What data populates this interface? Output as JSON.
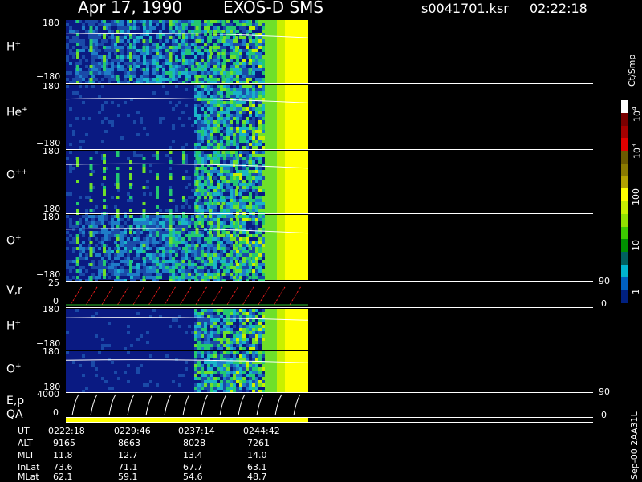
{
  "header": {
    "date": "Apr 17, 1990",
    "mission": "EXOS-D SMS",
    "file": "s0041701.ksr",
    "time": "02:22:18"
  },
  "panels": [
    {
      "label": "H",
      "sup": "+",
      "top_tick": "180",
      "bottom_tick": "−180"
    },
    {
      "label": "He",
      "sup": "+",
      "top_tick": "180",
      "bottom_tick": "−180"
    },
    {
      "label": "O",
      "sup": "++",
      "top_tick": "180",
      "bottom_tick": "−180"
    },
    {
      "label": "O",
      "sup": "+",
      "top_tick": "180",
      "bottom_tick": "−180"
    },
    {
      "label": "V,r",
      "sup": "",
      "top_tick": "25",
      "bottom_tick": "0",
      "right_top": "90",
      "right_bottom": "0"
    },
    {
      "label": "H",
      "sup": "+",
      "top_tick": "180",
      "bottom_tick": "−180"
    },
    {
      "label": "O",
      "sup": "+",
      "top_tick": "180",
      "bottom_tick": "−180"
    },
    {
      "label": "E,p",
      "sup": "",
      "top_tick": "4000",
      "bottom_tick": "0",
      "right_top": "90",
      "right_bottom": "0"
    },
    {
      "label": "QA",
      "sup": "",
      "top_tick": "",
      "bottom_tick": ""
    }
  ],
  "colorbar": {
    "unit": "Ct/Smp",
    "labels": [
      "10",
      "10",
      "100",
      "10",
      "1"
    ],
    "label_sups": [
      "4",
      "3",
      "",
      "",
      ""
    ],
    "colors": [
      "#ffffff",
      "#7a0000",
      "#a40000",
      "#e00000",
      "#6b5a00",
      "#8a7a00",
      "#b3a200",
      "#ffff00",
      "#c8f000",
      "#90e000",
      "#3cc800",
      "#009000",
      "#006060",
      "#00b4d0",
      "#0060c0",
      "#002080"
    ]
  },
  "footer": {
    "rows": [
      {
        "name": "UT",
        "values": [
          "0222:18",
          "0229:46",
          "0237:14",
          "0244:42"
        ]
      },
      {
        "name": "ALT",
        "values": [
          "9165",
          "8663",
          "8028",
          "7261"
        ]
      },
      {
        "name": "MLT",
        "values": [
          "11.8",
          "12.7",
          "13.4",
          "14.0"
        ]
      },
      {
        "name": "InLat",
        "values": [
          "73.6",
          "71.1",
          "67.7",
          "63.1"
        ]
      },
      {
        "name": "MLat",
        "values": [
          "62.1",
          "59.1",
          "54.6",
          "48.7"
        ]
      }
    ],
    "stamp": "Sep-00 2AA31L"
  },
  "chart_data": {
    "type": "heatmap",
    "title": "Apr 17, 1990   EXOS-D SMS",
    "x_ticks": [
      "0222:18",
      "0229:46",
      "0237:14",
      "0244:42"
    ],
    "panels": [
      "H+",
      "He+",
      "O++",
      "O+",
      "V,r",
      "H+",
      "O+",
      "E,p",
      "QA"
    ],
    "y_range_pitch": [
      -180,
      180
    ],
    "y_range_vr": [
      0,
      25
    ],
    "y_range_ep": [
      0,
      4000
    ],
    "colorbar_range": [
      1,
      10000
    ],
    "colorbar_unit": "Ct/Smp"
  }
}
